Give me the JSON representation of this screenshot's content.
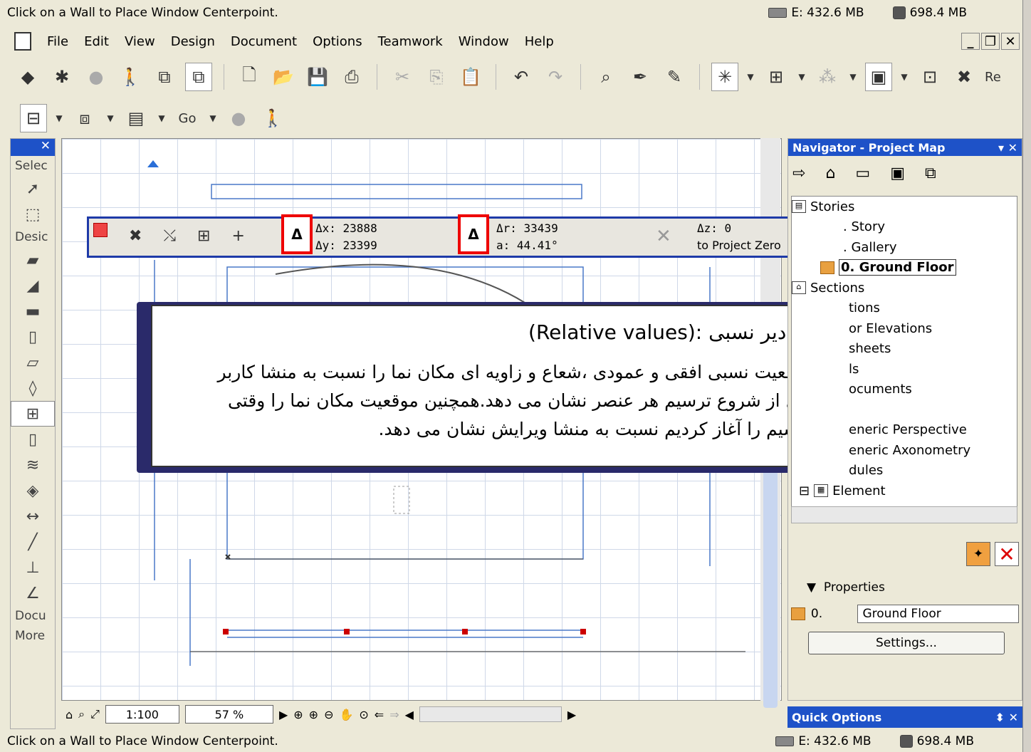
{
  "status_top": {
    "text": "Click on a Wall to Place Window Centerpoint.",
    "mem_e": "E: 432.6 MB",
    "mem_total": "698.4 MB"
  },
  "status_bottom": {
    "text": "Click on a Wall to Place Window Centerpoint.",
    "mem_e": "E: 432.6 MB",
    "mem_total": "698.4 MB"
  },
  "menu": [
    "File",
    "Edit",
    "View",
    "Design",
    "Document",
    "Options",
    "Teamwork",
    "Window",
    "Help"
  ],
  "toolbar2": {
    "go_label": "Go",
    "re_label": "Re"
  },
  "toolbox": {
    "select_label": "Selec",
    "design_label": "Desic",
    "docu_label": "Docu",
    "more_label": "More"
  },
  "petbar": {
    "dx": "Δx: 23888",
    "dy": "Δy: 23399",
    "dr": "Δr: 33439",
    "da": "a: 44.41°",
    "dz": "Δz: 0",
    "project_zero": "to Project Zero",
    "delta_symbol": "Δ"
  },
  "bubble": {
    "title": "مقادیر نسبی :(Relative values)",
    "line1": "موقعیت نسبی افقی و عمودی ،شعاع و زاویه ای مکان نما را نسبت به منشا کاربر",
    "line2": "قبل از شروع ترسیم هر عنصر نشان می دهد.همچنین موقعیت مکان نما را وقتی",
    "line3": "ترسیم را آغاز کردیم نسبت به منشا ویرایش نشان می دهد."
  },
  "navigator": {
    "title": "Navigator - Project Map",
    "tree": [
      ". Story",
      ". Gallery",
      "0. Ground Floor",
      "Sections",
      "tions",
      "or Elevations",
      "sheets",
      "ls",
      "ocuments",
      "",
      "eneric Perspective",
      "eneric Axonometry",
      "dules",
      "Element"
    ],
    "stories_label": "Stories",
    "properties_label": "Properties",
    "prop_id": "0.",
    "prop_value": "Ground Floor",
    "settings_button": "Settings..."
  },
  "bottom": {
    "scale": "1:100",
    "zoom": "57 %"
  },
  "quick_options": {
    "title": "Quick Options"
  }
}
